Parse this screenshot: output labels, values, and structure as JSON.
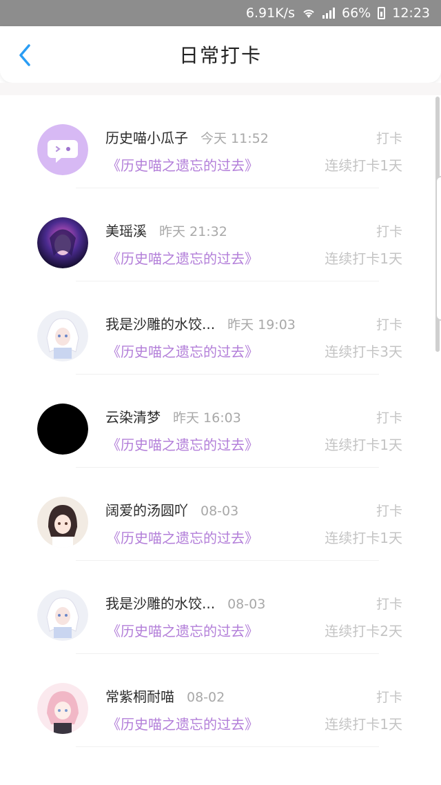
{
  "status_bar": {
    "speed": "6.91K/s",
    "battery": "66%",
    "time": "12:23"
  },
  "header": {
    "title": "日常打卡",
    "back_icon": "chevron-left-icon"
  },
  "colors": {
    "accent": "#b37fd9",
    "back": "#2a9df4",
    "muted": "#c4c4c4"
  },
  "records": [
    {
      "name": "历史喵小瓜子",
      "time": "今天 11:52",
      "book": "《历史喵之遗忘的过去》",
      "action": "打卡",
      "streak": "连续打卡1天",
      "avatar": "default-avatar-icon"
    },
    {
      "name": "美瑶溪",
      "time": "昨天 21:32",
      "book": "《历史喵之遗忘的过去》",
      "action": "打卡",
      "streak": "连续打卡1天",
      "avatar": "user-avatar"
    },
    {
      "name": "我是沙雕的水饺...",
      "time": "昨天 19:03",
      "book": "《历史喵之遗忘的过去》",
      "action": "打卡",
      "streak": "连续打卡3天",
      "avatar": "user-avatar"
    },
    {
      "name": "云染清梦",
      "time": "昨天 16:03",
      "book": "《历史喵之遗忘的过去》",
      "action": "打卡",
      "streak": "连续打卡1天",
      "avatar": "user-avatar"
    },
    {
      "name": "阔爱的汤圆吖",
      "time": "08-03",
      "book": "《历史喵之遗忘的过去》",
      "action": "打卡",
      "streak": "连续打卡1天",
      "avatar": "user-avatar"
    },
    {
      "name": "我是沙雕的水饺...",
      "time": "08-03",
      "book": "《历史喵之遗忘的过去》",
      "action": "打卡",
      "streak": "连续打卡2天",
      "avatar": "user-avatar"
    },
    {
      "name": "常紫桐耐喵",
      "time": "08-02",
      "book": "《历史喵之遗忘的过去》",
      "action": "打卡",
      "streak": "连续打卡1天",
      "avatar": "user-avatar"
    }
  ]
}
